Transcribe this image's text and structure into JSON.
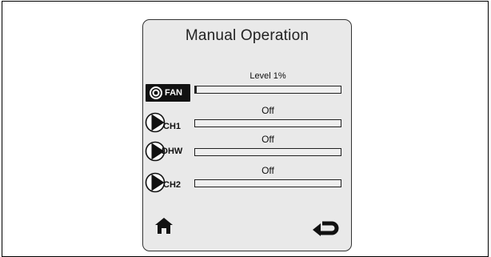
{
  "screen": {
    "title": "Manual Operation"
  },
  "rows": [
    {
      "label": "FAN",
      "status": "Level 1%",
      "level_percent": 1,
      "icon": "fan-icon"
    },
    {
      "label": "CH1",
      "status": "Off",
      "level_percent": 0,
      "icon": "pump-icon"
    },
    {
      "label": "DHW",
      "status": "Off",
      "level_percent": 0,
      "icon": "pump-icon"
    },
    {
      "label": "CH2",
      "status": "Off",
      "level_percent": 0,
      "icon": "pump-icon"
    }
  ],
  "nav": {
    "home_icon": "home-icon",
    "back_icon": "return-arrow-icon"
  },
  "colors": {
    "screen_background": "#e9e9e9",
    "icon_fill": "#111111"
  }
}
